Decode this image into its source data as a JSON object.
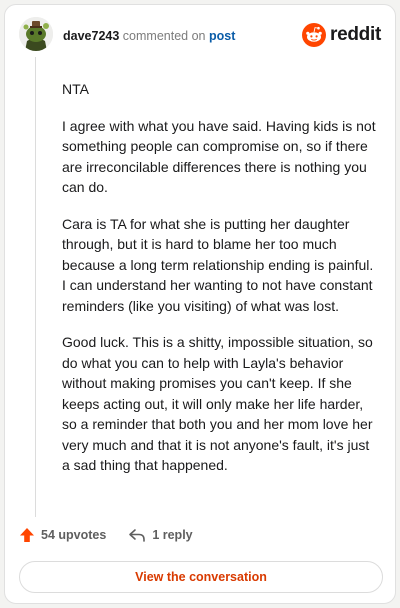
{
  "header": {
    "username": "dave7243",
    "commented_text": "commented on",
    "post_link": "post",
    "brand": "reddit"
  },
  "comment": {
    "paragraphs": [
      "NTA",
      "I agree with what you have said. Having kids is not something people can compromise on, so if there are irreconcilable differences there is nothing you can do.",
      "Cara is TA for what she is putting her daughter through, but it is hard to blame her too much because a long term relationship ending is painful. I can understand her wanting to not have constant reminders (like you visiting) of what was lost.",
      "Good luck. This is a shitty, impossible situation, so do what you can to help with Layla's behavior without making promises you can't keep. If she keeps acting out, it will only make her life harder, so a reminder that both you and her mom love her very much and that it is not anyone's fault, it's just a sad thing that happened."
    ]
  },
  "footer": {
    "upvotes": "54 upvotes",
    "replies": "1 reply",
    "view_button": "View the conversation"
  },
  "colors": {
    "brand_orange": "#ff4500",
    "button_text": "#d93a00",
    "link_blue": "#0a5ca8"
  },
  "icons": {
    "avatar": "snoo-avatar-icon",
    "logo": "reddit-logo-icon",
    "upvote": "upvote-arrow-icon",
    "reply": "reply-arrow-icon"
  }
}
